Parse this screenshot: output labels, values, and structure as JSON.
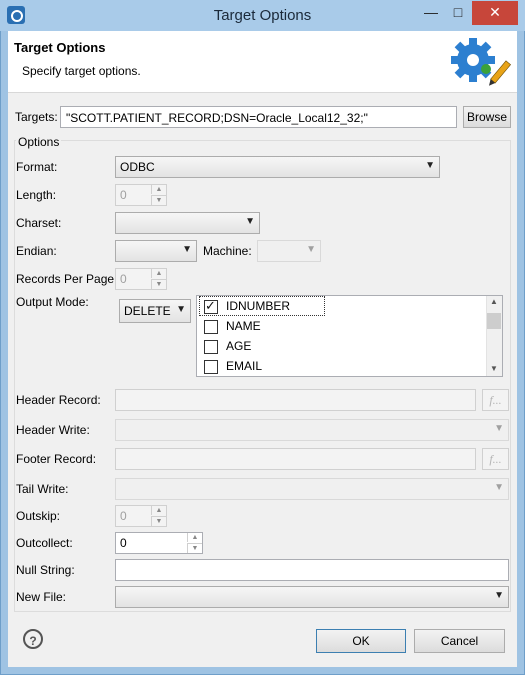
{
  "window": {
    "title": "Target Options"
  },
  "header": {
    "title": "Target Options",
    "description": "Specify target options."
  },
  "targets": {
    "label": "Targets:",
    "value": "\"SCOTT.PATIENT_RECORD;DSN=Oracle_Local12_32;\"",
    "browse_label": "Browse"
  },
  "options": {
    "legend": "Options",
    "format": {
      "label": "Format:",
      "value": "ODBC"
    },
    "length": {
      "label": "Length:",
      "value": "0"
    },
    "charset": {
      "label": "Charset:",
      "value": ""
    },
    "endian": {
      "label": "Endian:",
      "value": ""
    },
    "machine": {
      "label": "Machine:",
      "value": ""
    },
    "records_per_page": {
      "label": "Records Per Page:",
      "value": "0"
    },
    "output_mode": {
      "label": "Output Mode:",
      "value": "DELETE"
    },
    "fields": [
      {
        "name": "IDNUMBER",
        "checked": true
      },
      {
        "name": "NAME",
        "checked": false
      },
      {
        "name": "AGE",
        "checked": false
      },
      {
        "name": "EMAIL",
        "checked": false
      }
    ],
    "header_record": {
      "label": "Header Record:",
      "value": "",
      "fx_label": "f..."
    },
    "header_write": {
      "label": "Header Write:",
      "value": ""
    },
    "footer_record": {
      "label": "Footer Record:",
      "value": "",
      "fx_label": "f..."
    },
    "tail_write": {
      "label": "Tail Write:",
      "value": ""
    },
    "outskip": {
      "label": "Outskip:",
      "value": "0"
    },
    "outcollect": {
      "label": "Outcollect:",
      "value": "0"
    },
    "null_string": {
      "label": "Null String:",
      "value": ""
    },
    "new_file": {
      "label": "New File:",
      "value": ""
    }
  },
  "buttons": {
    "ok": "OK",
    "cancel": "Cancel",
    "help": "?"
  },
  "colors": {
    "titlebar": "#a9cbe9",
    "close": "#c7463a",
    "gear": "#2c7fd0"
  }
}
